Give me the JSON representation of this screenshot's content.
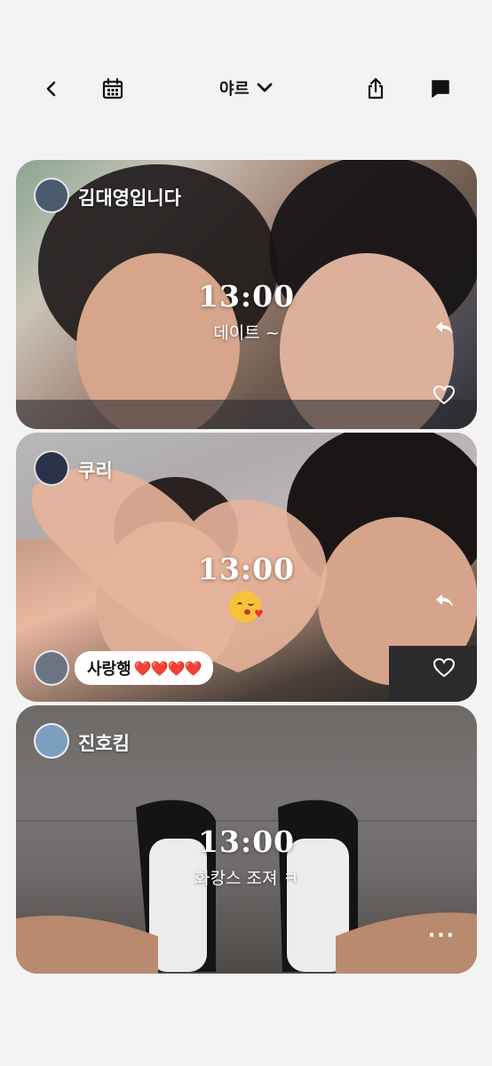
{
  "header": {
    "title": "야르",
    "back_icon": "chevron-left-icon",
    "calendar_icon": "calendar-icon",
    "share_icon": "share-icon",
    "chat_icon": "chat-icon"
  },
  "posts": [
    {
      "author": "김대영입니다",
      "time": "13:00",
      "caption": "데이트 ~",
      "colors": {
        "avatar": "#4c5a6e"
      }
    },
    {
      "author": "쿠리",
      "time": "13:00",
      "emoji": "kissing-heart-emoji",
      "reaction": {
        "text": "사랑행",
        "hearts": "❤️❤️❤️❤️"
      },
      "colors": {
        "avatar": "#2a3148",
        "reaction_avatar": "#6b7584"
      }
    },
    {
      "author": "진호킴",
      "time": "13:00",
      "caption": "화캉스 조져 ㅋ",
      "more_label": "···",
      "colors": {
        "avatar": "#7d9fbf"
      }
    }
  ]
}
